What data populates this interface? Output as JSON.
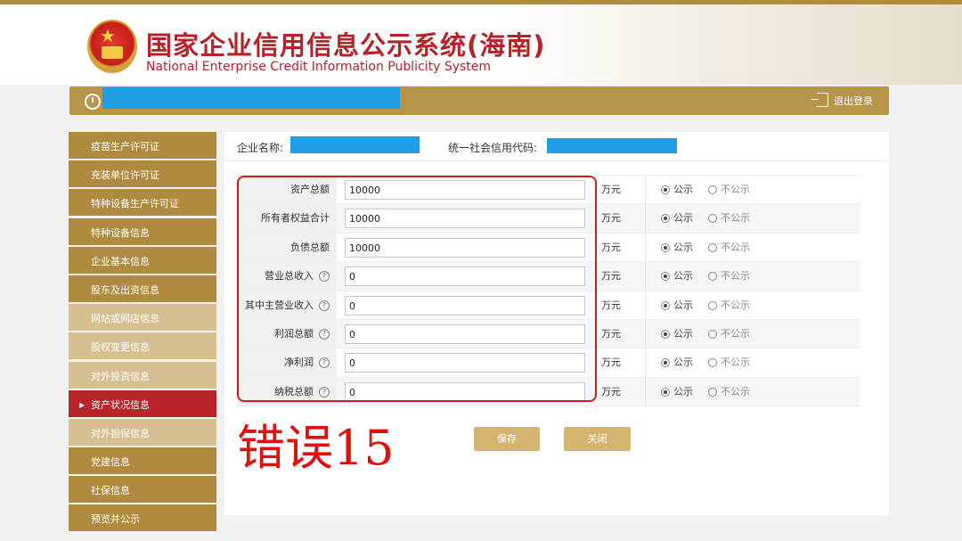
{
  "header": {
    "title_cn": "国家企业信用信息公示系统(海南)",
    "title_en": "National Enterprise Credit Information Publicity System"
  },
  "topbar": {
    "logout_label": "退出登录"
  },
  "sidebar": {
    "items": [
      {
        "label": "疫苗生产许可证",
        "style": "dark"
      },
      {
        "label": "充装单位许可证",
        "style": "dark"
      },
      {
        "label": "特种设备生产许可证",
        "style": "dark"
      },
      {
        "label": "特种设备信息",
        "style": "dark"
      },
      {
        "label": "企业基本信息",
        "style": "dark"
      },
      {
        "label": "股东及出资信息",
        "style": "dark"
      },
      {
        "label": "网站或网店信息",
        "style": "light"
      },
      {
        "label": "股权变更信息",
        "style": "light"
      },
      {
        "label": "对外投资信息",
        "style": "light"
      },
      {
        "label": "资产状况信息",
        "style": "active"
      },
      {
        "label": "对外担保信息",
        "style": "light"
      },
      {
        "label": "党建信息",
        "style": "dark"
      },
      {
        "label": "社保信息",
        "style": "dark"
      },
      {
        "label": "预览并公示",
        "style": "dark"
      }
    ]
  },
  "company": {
    "name_label": "企业名称:",
    "code_label": "统一社会信用代码:"
  },
  "form": {
    "unit": "万元",
    "public_label": "公示",
    "private_label": "不公示",
    "rows": [
      {
        "label": "资产总额",
        "value": "10000",
        "help": false
      },
      {
        "label": "所有者权益合计",
        "value": "10000",
        "help": false
      },
      {
        "label": "负债总额",
        "value": "10000",
        "help": false
      },
      {
        "label": "营业总收入",
        "value": "0",
        "help": true
      },
      {
        "label": "其中主营业收入",
        "value": "0",
        "help": true
      },
      {
        "label": "利润总额",
        "value": "0",
        "help": true
      },
      {
        "label": "净利润",
        "value": "0",
        "help": true
      },
      {
        "label": "纳税总额",
        "value": "0",
        "help": true
      }
    ]
  },
  "annotation": {
    "text": "错误15",
    "color": "#e01010"
  },
  "buttons": {
    "save": "保存",
    "close": "关闭"
  },
  "colors": {
    "brand_red": "#b5232a",
    "gold": "#b08a3e",
    "redaction_blue": "#1f9ee5"
  }
}
